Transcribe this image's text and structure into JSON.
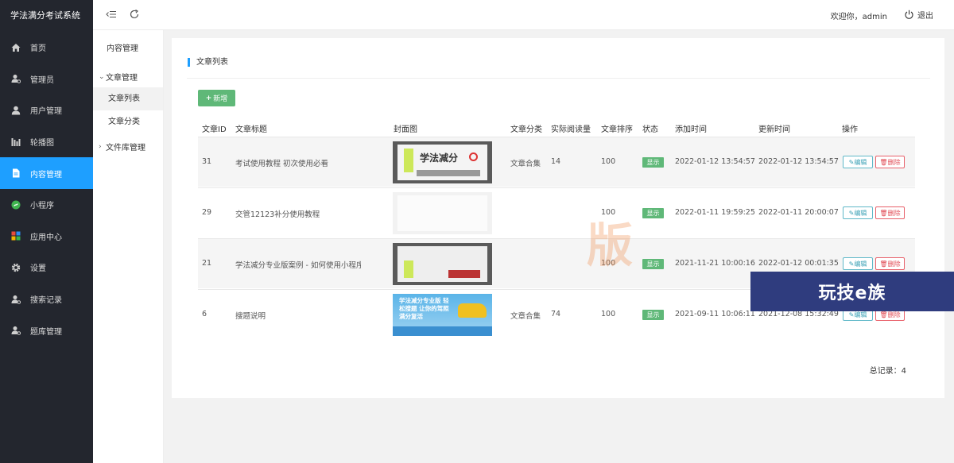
{
  "app": {
    "title": "学法满分考试系统"
  },
  "nav": {
    "items": [
      {
        "label": "首页",
        "icon": "home-icon"
      },
      {
        "label": "管理员",
        "icon": "user-gear-icon"
      },
      {
        "label": "用户管理",
        "icon": "user-icon"
      },
      {
        "label": "轮播图",
        "icon": "carousel-icon"
      },
      {
        "label": "内容管理",
        "icon": "document-icon",
        "active": true
      },
      {
        "label": "小程序",
        "icon": "miniprogram-icon"
      },
      {
        "label": "应用中心",
        "icon": "apps-icon"
      },
      {
        "label": "设置",
        "icon": "gear-icon"
      },
      {
        "label": "搜索记录",
        "icon": "user-search-icon"
      },
      {
        "label": "题库管理",
        "icon": "user-bank-icon"
      }
    ]
  },
  "subnav": {
    "header": "内容管理",
    "group_article": "文章管理",
    "link_list": "文章列表",
    "link_category": "文章分类",
    "group_library": "文件库管理"
  },
  "header": {
    "welcome": "欢迎你，admin",
    "logout": "退出"
  },
  "card": {
    "title": "文章列表",
    "add_button": "新增",
    "total": "总记录：4"
  },
  "table": {
    "columns": [
      "文章ID",
      "文章标题",
      "封面图",
      "文章分类",
      "实际阅读量",
      "文章排序",
      "状态",
      "添加时间",
      "更新时间",
      "操作"
    ],
    "edit_label": "编辑",
    "delete_label": "删除",
    "rows": [
      {
        "id": "31",
        "title": "考试使用教程 初次使用必看",
        "category": "文章合集",
        "views": "14",
        "sort": "100",
        "status": "显示",
        "added": "2022-01-12 13:54:57",
        "updated": "2022-01-12 13:54:57",
        "cover_text": "学法减分"
      },
      {
        "id": "29",
        "title": "交管12123补分使用教程",
        "category": "",
        "views": "",
        "sort": "100",
        "status": "显示",
        "added": "2022-01-11 19:59:25",
        "updated": "2022-01-11 20:00:07",
        "cover_text": ""
      },
      {
        "id": "21",
        "title": "学法减分专业版案例 - 如何使用小程序",
        "category": "",
        "views": "",
        "sort": "100",
        "status": "显示",
        "added": "2021-11-21 10:00:16",
        "updated": "2022-01-12 00:01:35",
        "cover_text": ""
      },
      {
        "id": "6",
        "title": "搜题说明",
        "category": "文章合集",
        "views": "74",
        "sort": "100",
        "status": "显示",
        "added": "2021-09-11 10:06:11",
        "updated": "2021-12-08 15:32:49",
        "cover_text": "学法减分专业版 轻松搜题 让你的驾照满分复活"
      }
    ]
  },
  "watermark": {
    "banner": "玩技e族",
    "center": "版"
  },
  "colors": {
    "sidebar": "#23262e",
    "accent": "#1e9fff",
    "success": "#5fb878"
  }
}
